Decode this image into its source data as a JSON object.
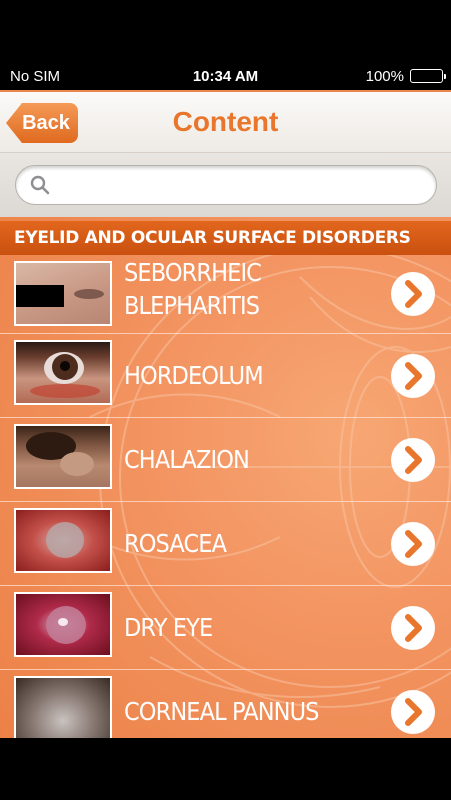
{
  "status_bar": {
    "carrier": "No SIM",
    "time": "10:34 AM",
    "battery": "100%",
    "battery_level": 1.0
  },
  "nav": {
    "back_label": "Back",
    "title": "Content"
  },
  "search": {
    "value": "",
    "placeholder": ""
  },
  "section": {
    "title": "EYELID AND OCULAR SURFACE DISORDERS"
  },
  "items": [
    {
      "label_line1": "SEBORRHEIC",
      "label_line2": "BLEPHARITIS",
      "thumb_icon": "photo-seborrheic-blepharitis"
    },
    {
      "label_line1": "HORDEOLUM",
      "label_line2": "",
      "thumb_icon": "photo-hordeolum"
    },
    {
      "label_line1": "CHALAZION",
      "label_line2": "",
      "thumb_icon": "photo-chalazion"
    },
    {
      "label_line1": "ROSACEA",
      "label_line2": "",
      "thumb_icon": "photo-rosacea"
    },
    {
      "label_line1": "DRY EYE",
      "label_line2": "",
      "thumb_icon": "photo-dry-eye"
    },
    {
      "label_line1": "CORNEAL PANNUS",
      "label_line2": "",
      "thumb_icon": "photo-corneal-pannus"
    }
  ],
  "colors": {
    "accent": "#e8762c",
    "header_bg": "#d65a16",
    "list_bg": "#f39562",
    "chevron": "#e8762c"
  }
}
